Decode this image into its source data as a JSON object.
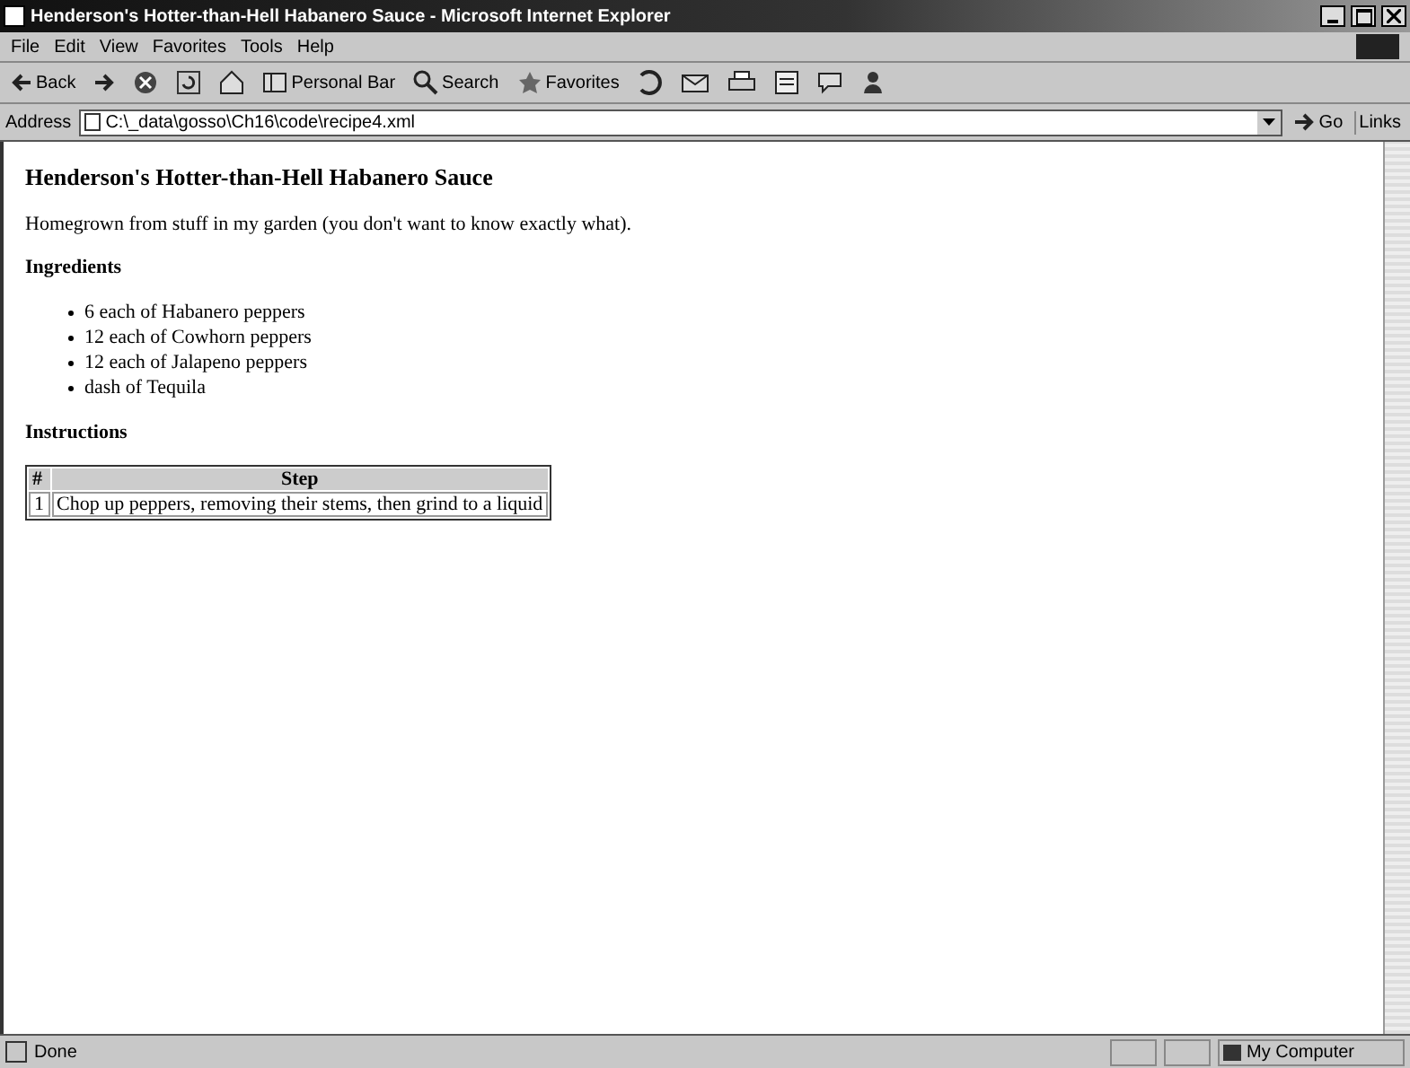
{
  "window": {
    "title": "Henderson's Hotter-than-Hell Habanero Sauce - Microsoft Internet Explorer"
  },
  "menu": [
    "File",
    "Edit",
    "View",
    "Favorites",
    "Tools",
    "Help"
  ],
  "toolbar": [
    {
      "kind": "back",
      "label": "Back"
    },
    {
      "kind": "forward"
    },
    {
      "kind": "stop"
    },
    {
      "kind": "refresh"
    },
    {
      "kind": "home"
    },
    {
      "kind": "personal",
      "label": "Personal Bar"
    },
    {
      "kind": "search",
      "label": "Search"
    },
    {
      "kind": "favorites",
      "label": "Favorites"
    },
    {
      "kind": "history"
    },
    {
      "kind": "mail"
    },
    {
      "kind": "print"
    },
    {
      "kind": "edit"
    },
    {
      "kind": "discuss"
    },
    {
      "kind": "messenger"
    }
  ],
  "address": {
    "label": "Address",
    "value": "C:\\_data\\gosso\\Ch16\\code\\recipe4.xml",
    "go": "Go",
    "links": "Links"
  },
  "page": {
    "heading": "Henderson's Hotter-than-Hell Habanero Sauce",
    "intro": "Homegrown from stuff in my garden (you don't want to know exactly what).",
    "ingredients_heading": "Ingredients",
    "ingredients": [
      "6 each of Habanero peppers",
      "12 each of Cowhorn peppers",
      "12 each of Jalapeno peppers",
      "dash of Tequila"
    ],
    "instructions_heading": "Instructions",
    "table": {
      "columns": [
        "#",
        "Step"
      ],
      "rows": [
        [
          "1",
          "Chop up peppers, removing their stems, then grind to a liquid"
        ]
      ]
    }
  },
  "status_bar": {
    "text": "Done",
    "zone": "My Computer"
  }
}
